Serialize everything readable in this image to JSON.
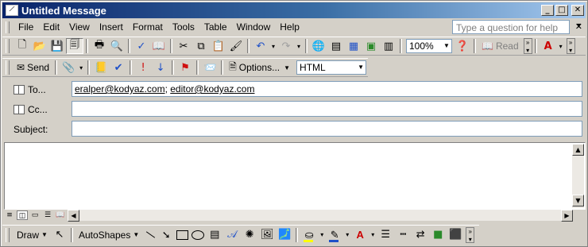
{
  "window": {
    "title": "Untitled Message",
    "min": "_",
    "max": "□",
    "close": "✕"
  },
  "menubar": {
    "items": [
      "File",
      "Edit",
      "View",
      "Insert",
      "Format",
      "Tools",
      "Table",
      "Window",
      "Help"
    ],
    "help_placeholder": "Type a question for help",
    "close": "✕"
  },
  "standard_toolbar": {
    "zoom": "100%",
    "read_label": "Read"
  },
  "email_toolbar": {
    "send_label": "Send",
    "options_label": "Options...",
    "format_value": "HTML"
  },
  "header": {
    "to_label": "To...",
    "cc_label": "Cc...",
    "subject_label": "Subject:",
    "to_recipients": [
      "eralper@kodyaz.com",
      "editor@kodyaz.com"
    ],
    "separator": ";",
    "cc_value": "",
    "subject_value": ""
  },
  "drawing_toolbar": {
    "draw_label": "Draw",
    "autoshapes_label": "AutoShapes"
  },
  "colors": {
    "title_start": "#0a246a",
    "title_end": "#a6caf0",
    "fill_highlight": "#ffff00",
    "line_color": "#1e50c8",
    "font_color": "#d01010"
  }
}
